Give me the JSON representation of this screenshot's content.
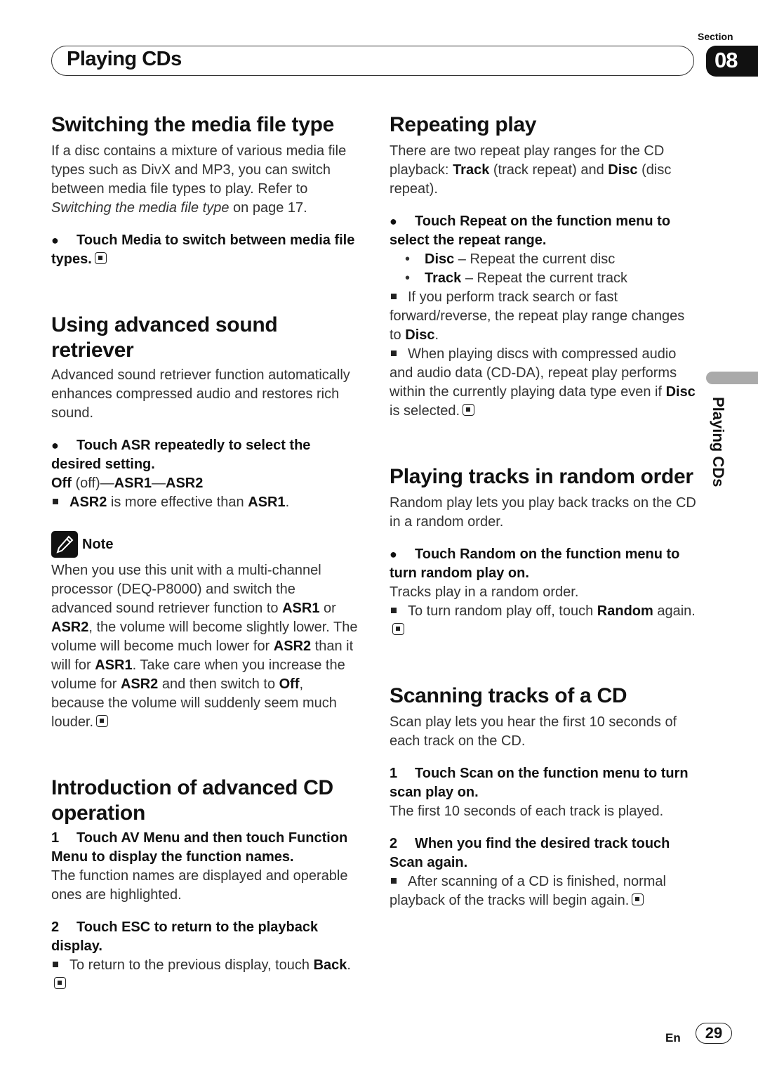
{
  "header": {
    "section_label": "Section",
    "section_number": "08",
    "chapter_title": "Playing CDs"
  },
  "side_tab": {
    "label": "Playing CDs"
  },
  "footer": {
    "language": "En",
    "page_number": "29"
  },
  "left_column": {
    "switching": {
      "heading": "Switching the media file type",
      "body_1": "If a disc contains a mixture of various media file types such as DivX and MP3, you can switch between media file types to play. Refer to ",
      "body_ref": "Switching the media file type",
      "body_2": " on page 17.",
      "step_bullet": "●",
      "step_text": "Touch Media to switch between media file types."
    },
    "asr": {
      "heading": "Using advanced sound retriever",
      "body": "Advanced sound retriever function automatically enhances compressed audio and restores rich sound.",
      "step_bullet": "●",
      "step_text": "Touch ASR repeatedly to select the desired setting.",
      "sequence_off": "Off",
      "sequence_off_paren": " (off)—",
      "sequence_asr1": "ASR1",
      "sequence_dash": "—",
      "sequence_asr2": "ASR2",
      "tip_bold_1": "ASR2",
      "tip_text": " is more effective than ",
      "tip_bold_2": "ASR1",
      "tip_end": "."
    },
    "note": {
      "title": "Note",
      "t1": "When you use this unit with a multi-channel processor (DEQ-P8000) and switch the advanced sound retriever function to ",
      "b1": "ASR1",
      "t2": " or ",
      "b2": "ASR2",
      "t3": ", the volume will become slightly lower. The volume will become much lower for ",
      "b3": "ASR2",
      "t4": " than it will for ",
      "b4": "ASR1",
      "t5": ". Take care when you increase the volume for ",
      "b5": "ASR2",
      "t6": " and then switch to ",
      "b6": "Off",
      "t7": ", because the volume will suddenly seem much louder."
    },
    "intro": {
      "heading": "Introduction of advanced CD operation",
      "step1_num": "1",
      "step1_text": "Touch AV Menu and then touch Function Menu to display the function names.",
      "step1_body": "The function names are displayed and operable ones are highlighted.",
      "step2_num": "2",
      "step2_text": "Touch ESC to return to the playback display.",
      "step2_tip": "To return to the previous display, touch ",
      "step2_tip_bold": "Back",
      "step2_tip_end": "."
    }
  },
  "right_column": {
    "repeat": {
      "heading": "Repeating play",
      "b_t1": "There are two repeat play ranges for the CD playback: ",
      "b_track": "Track",
      "b_t2": " (track repeat) and ",
      "b_disc": "Disc",
      "b_t3": " (disc repeat).",
      "step_bullet": "●",
      "step_text": "Touch Repeat on the function menu to select the repeat range.",
      "options": [
        {
          "name": "Disc",
          "desc": " – Repeat the current disc"
        },
        {
          "name": "Track",
          "desc": " – Repeat the current track"
        }
      ],
      "tip1": "If you perform track search or fast forward/reverse, the repeat play range changes to ",
      "tip1_bold": "Disc",
      "tip1_end": ".",
      "tip2": "When playing discs with compressed audio and audio data (CD-DA), repeat play performs within the currently playing data type even if ",
      "tip2_bold": "Disc",
      "tip2_end": " is selected."
    },
    "random": {
      "heading": "Playing tracks in random order",
      "body": "Random play lets you play back tracks on the CD in a random order.",
      "step_bullet": "●",
      "step_text": "Touch Random on the function menu to turn random play on.",
      "step_body": "Tracks play in a random order.",
      "tip": "To turn random play off, touch ",
      "tip_bold": "Random",
      "tip_end": " again."
    },
    "scan": {
      "heading": "Scanning tracks of a CD",
      "body": "Scan play lets you hear the first 10 seconds of each track on the CD.",
      "step1_num": "1",
      "step1_text": "Touch Scan on the function menu to turn scan play on.",
      "step1_body": "The first 10 seconds of each track is played.",
      "step2_num": "2",
      "step2_text": "When you find the desired track touch Scan again.",
      "tip": "After scanning of a CD is finished, normal playback of the tracks will begin again."
    }
  }
}
